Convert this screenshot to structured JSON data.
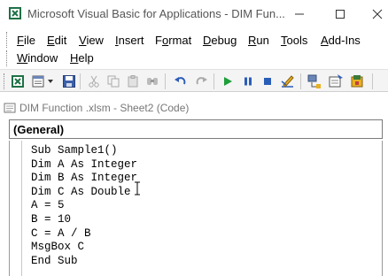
{
  "window": {
    "title": "Microsoft Visual Basic for Applications - DIM Fun..."
  },
  "menu": {
    "items": [
      {
        "label": "File",
        "accel": "F"
      },
      {
        "label": "Edit",
        "accel": "E"
      },
      {
        "label": "View",
        "accel": "V"
      },
      {
        "label": "Insert",
        "accel": "I"
      },
      {
        "label": "Format",
        "accel": "o"
      },
      {
        "label": "Debug",
        "accel": "D"
      },
      {
        "label": "Run",
        "accel": "R"
      },
      {
        "label": "Tools",
        "accel": "T"
      },
      {
        "label": "Add-Ins",
        "accel": "A"
      },
      {
        "label": "Window",
        "accel": "W"
      },
      {
        "label": "Help",
        "accel": "H"
      }
    ]
  },
  "toolbar": {
    "icons": [
      "view-excel-icon",
      "insert-module-icon",
      "dropdown-arrow-icon",
      "save-icon",
      "cut-icon",
      "copy-icon",
      "paste-icon",
      "find-icon",
      "undo-icon",
      "redo-icon",
      "run-icon",
      "break-icon",
      "reset-icon",
      "design-mode-icon",
      "project-explorer-icon",
      "properties-icon",
      "object-browser-icon"
    ]
  },
  "code_window": {
    "title": "DIM Function .xlsm - Sheet2 (Code)",
    "object_selector": "(General)",
    "lines": [
      "Sub Sample1()",
      "Dim A As Integer",
      "Dim B As Integer",
      "Dim C As Double",
      "A = 5",
      "B = 10",
      "C = A / B",
      "MsgBox C",
      "End Sub"
    ]
  },
  "colors": {
    "run_green": "#1e9e3a",
    "pause_blue": "#2a5db8",
    "title_gray": "#555555"
  }
}
